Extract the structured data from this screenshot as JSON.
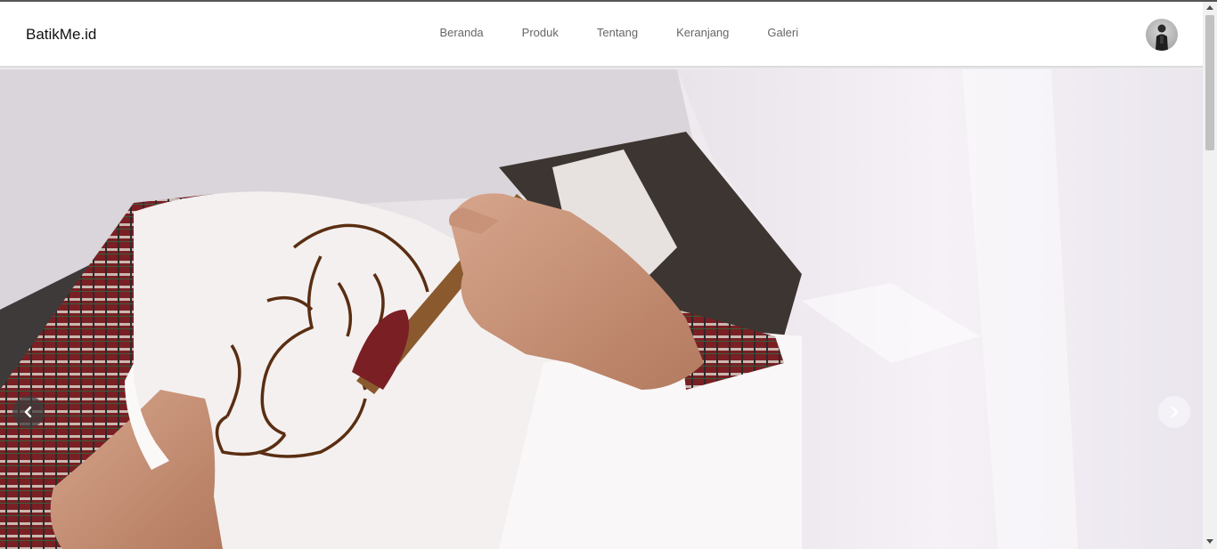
{
  "brand": {
    "name": "BatikMe.id"
  },
  "nav": {
    "items": [
      {
        "label": "Beranda"
      },
      {
        "label": "Produk"
      },
      {
        "label": "Tentang"
      },
      {
        "label": "Keranjang"
      },
      {
        "label": "Galeri"
      }
    ]
  },
  "hero": {
    "image_subject": "hands drawing batik with canting on white cloth",
    "controls": {
      "prev_icon": "chevron-left-icon",
      "next_icon": "chevron-right-icon"
    }
  },
  "colors": {
    "nav_text": "#666666",
    "brand_text": "#111111",
    "accent_fabric": "#7a1f24",
    "wax": "#5a2e12"
  }
}
